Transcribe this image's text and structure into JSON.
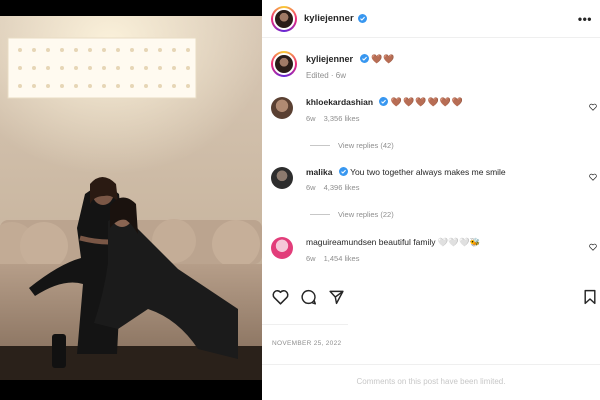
{
  "post": {
    "username": "kyliejenner",
    "date": "NOVEMBER 25, 2022",
    "comments_limited_text": "Comments on this post have been limited."
  },
  "caption": {
    "username": "kyliejenner",
    "text": "🤎🤎",
    "meta": "Edited · 6w"
  },
  "comments": [
    {
      "username": "khloekardashian",
      "verified": true,
      "text": "🤎🤎🤎🤎🤎🤎",
      "age": "6w",
      "likes": "3,356 likes",
      "replies": "View replies (42)",
      "avatar_color": "#8a6b57"
    },
    {
      "username": "malika",
      "verified": true,
      "text": "You two together always makes me smile",
      "age": "6w",
      "likes": "4,396 likes",
      "replies": "View replies (22)",
      "avatar_color": "#3c3c3c"
    },
    {
      "username": "maguireamundsen",
      "verified": false,
      "text": "beautiful family 🤍🤍🤍🐝",
      "age": "6w",
      "likes": "1,454 likes",
      "avatar_color": "#e23d7a"
    }
  ],
  "actions": [
    "heart-icon",
    "comment-icon",
    "share-icon",
    "bookmark-icon"
  ],
  "colors": {
    "verified_blue": "#3897f0",
    "muted_text": "#8e8e8e",
    "heart_brown": "#7a4a1d"
  }
}
